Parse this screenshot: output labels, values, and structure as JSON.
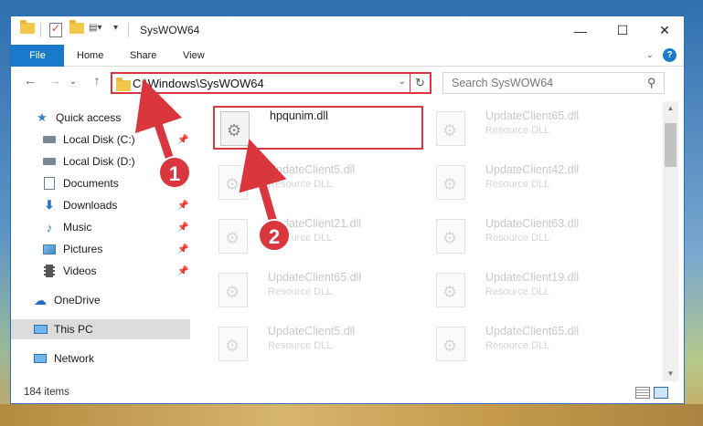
{
  "window": {
    "title": "SysWOW64"
  },
  "ribbon": {
    "tabs": [
      "File",
      "Home",
      "Share",
      "View"
    ]
  },
  "address": {
    "path": "C:\\Windows\\SysWOW64",
    "search_placeholder": "Search SysWOW64"
  },
  "sidebar": {
    "items": [
      {
        "label": "Quick access",
        "icon": "star-icon"
      },
      {
        "label": "Local Disk (C:)",
        "icon": "disk-icon",
        "pinned": true
      },
      {
        "label": "Local Disk (D:)",
        "icon": "disk-icon",
        "pinned": false
      },
      {
        "label": "Documents",
        "icon": "documents-icon",
        "pinned": true
      },
      {
        "label": "Downloads",
        "icon": "download-icon",
        "pinned": true
      },
      {
        "label": "Music",
        "icon": "music-icon",
        "pinned": true
      },
      {
        "label": "Pictures",
        "icon": "pictures-icon",
        "pinned": true
      },
      {
        "label": "Videos",
        "icon": "videos-icon",
        "pinned": true
      },
      {
        "label": "OneDrive",
        "icon": "cloud-icon"
      },
      {
        "label": "This PC",
        "icon": "computer-icon",
        "selected": true
      },
      {
        "label": "Network",
        "icon": "network-icon"
      }
    ]
  },
  "files": [
    {
      "name": "hpqunim.dll",
      "type": ""
    },
    {
      "name": "UpdateClient65.dll",
      "type": "Resource DLL"
    },
    {
      "name": "UpdateClient5.dll",
      "type": "Resource DLL"
    },
    {
      "name": "UpdateClient42.dll",
      "type": "Resource DLL"
    },
    {
      "name": "UpdateClient21.dll",
      "type": "Resource DLL"
    },
    {
      "name": "UpdateClient63.dll",
      "type": "Resource DLL"
    },
    {
      "name": "UpdateClient65.dll",
      "type": "Resource DLL"
    },
    {
      "name": "UpdateClient19.dll",
      "type": "Resource DLL"
    },
    {
      "name": "UpdateClient5.dll",
      "type": "Resource DLL"
    },
    {
      "name": "UpdateClient65.dll",
      "type": "Resource DLL"
    }
  ],
  "status": {
    "item_count": "184 items"
  },
  "annotations": {
    "step1": "1",
    "step2": "2"
  },
  "colors": {
    "accent": "#1979ca",
    "highlight": "#d9363e"
  }
}
